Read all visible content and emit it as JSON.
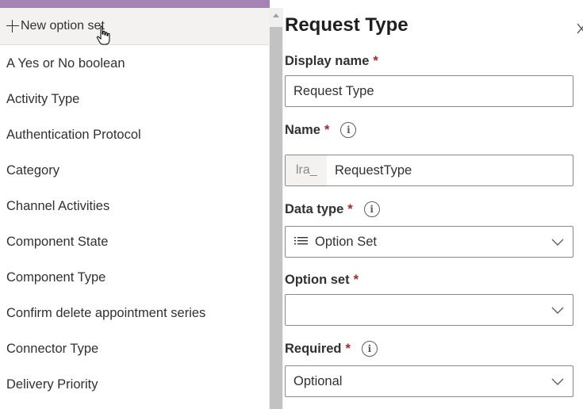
{
  "dropdown": {
    "new_option_label": "New option set",
    "items": [
      "A Yes or No boolean",
      "Activity Type",
      "Authentication Protocol",
      "Category",
      "Channel Activities",
      "Component State",
      "Component Type",
      "Confirm delete appointment series",
      "Connector Type",
      "Delivery Priority"
    ]
  },
  "panel": {
    "title": "Request Type",
    "display_name": {
      "label": "Display name",
      "required_mark": "*",
      "value": "Request Type"
    },
    "name": {
      "label": "Name",
      "required_mark": "*",
      "prefix": "lra_",
      "value": "RequestType"
    },
    "data_type": {
      "label": "Data type",
      "required_mark": "*",
      "value": "Option Set"
    },
    "option_set": {
      "label": "Option set",
      "required_mark": "*",
      "value": ""
    },
    "required": {
      "label": "Required",
      "required_mark": "*",
      "value": "Optional"
    },
    "info_glyph": "i"
  },
  "colors": {
    "accent_strip": "#a583b5",
    "required_star": "#a4262c",
    "border": "#8a8886"
  }
}
